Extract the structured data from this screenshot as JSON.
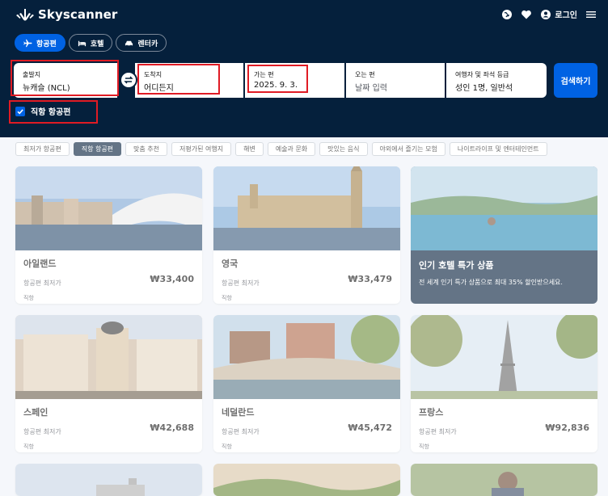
{
  "brand": {
    "name": "Skyscanner"
  },
  "header": {
    "login_label": "로그인"
  },
  "tabs": [
    {
      "label": "항공편",
      "icon": "plane-icon",
      "active": true
    },
    {
      "label": "호텔",
      "icon": "bed-icon",
      "active": false
    },
    {
      "label": "렌터카",
      "icon": "car-icon",
      "active": false
    }
  ],
  "search": {
    "origin": {
      "label": "출발지",
      "value": "뉴캐슬 (NCL)"
    },
    "destination": {
      "label": "도착지",
      "value": "어디든지"
    },
    "depart": {
      "label": "가는 편",
      "value": "2025. 9. 3."
    },
    "return": {
      "label": "오는 편",
      "placeholder": "날짜 입력"
    },
    "travelers": {
      "label": "여행자 및 좌석 등급",
      "value": "성인 1명, 일반석"
    },
    "button_label": "검색하기",
    "direct_label": "직항 항공편",
    "direct_checked": true
  },
  "filters": [
    {
      "label": "최저가 항공편",
      "active": false
    },
    {
      "label": "직항 항공편",
      "active": true
    },
    {
      "label": "맞춤 추천",
      "active": false
    },
    {
      "label": "저평가된 여행지",
      "active": false
    },
    {
      "label": "해변",
      "active": false
    },
    {
      "label": "예술과 문화",
      "active": false
    },
    {
      "label": "맛있는 음식",
      "active": false
    },
    {
      "label": "야외에서 즐기는 모험",
      "active": false
    },
    {
      "label": "나이트라이프 및 엔터테인먼트",
      "active": false
    }
  ],
  "cards": [
    {
      "name": "아일랜드",
      "sub": "항공편 최저가",
      "price": "₩33,400",
      "tag": "직항"
    },
    {
      "name": "영국",
      "sub": "항공편 최저가",
      "price": "₩33,479",
      "tag": "직항"
    },
    {
      "name": "스페인",
      "sub": "항공편 최저가",
      "price": "₩42,688",
      "tag": "직항"
    },
    {
      "name": "네덜란드",
      "sub": "항공편 최저가",
      "price": "₩45,472",
      "tag": "직항"
    },
    {
      "name": "프랑스",
      "sub": "항공편 최저가",
      "price": "₩92,836",
      "tag": "직항"
    }
  ],
  "promo": {
    "title": "인기 호텔 특가 상품",
    "description": "전 세계 인기 특가 상품으로 최대 35% 할인받으세요."
  },
  "colors": {
    "navy": "#05203c",
    "blue": "#0062e3",
    "highlight": "#e01b24"
  }
}
